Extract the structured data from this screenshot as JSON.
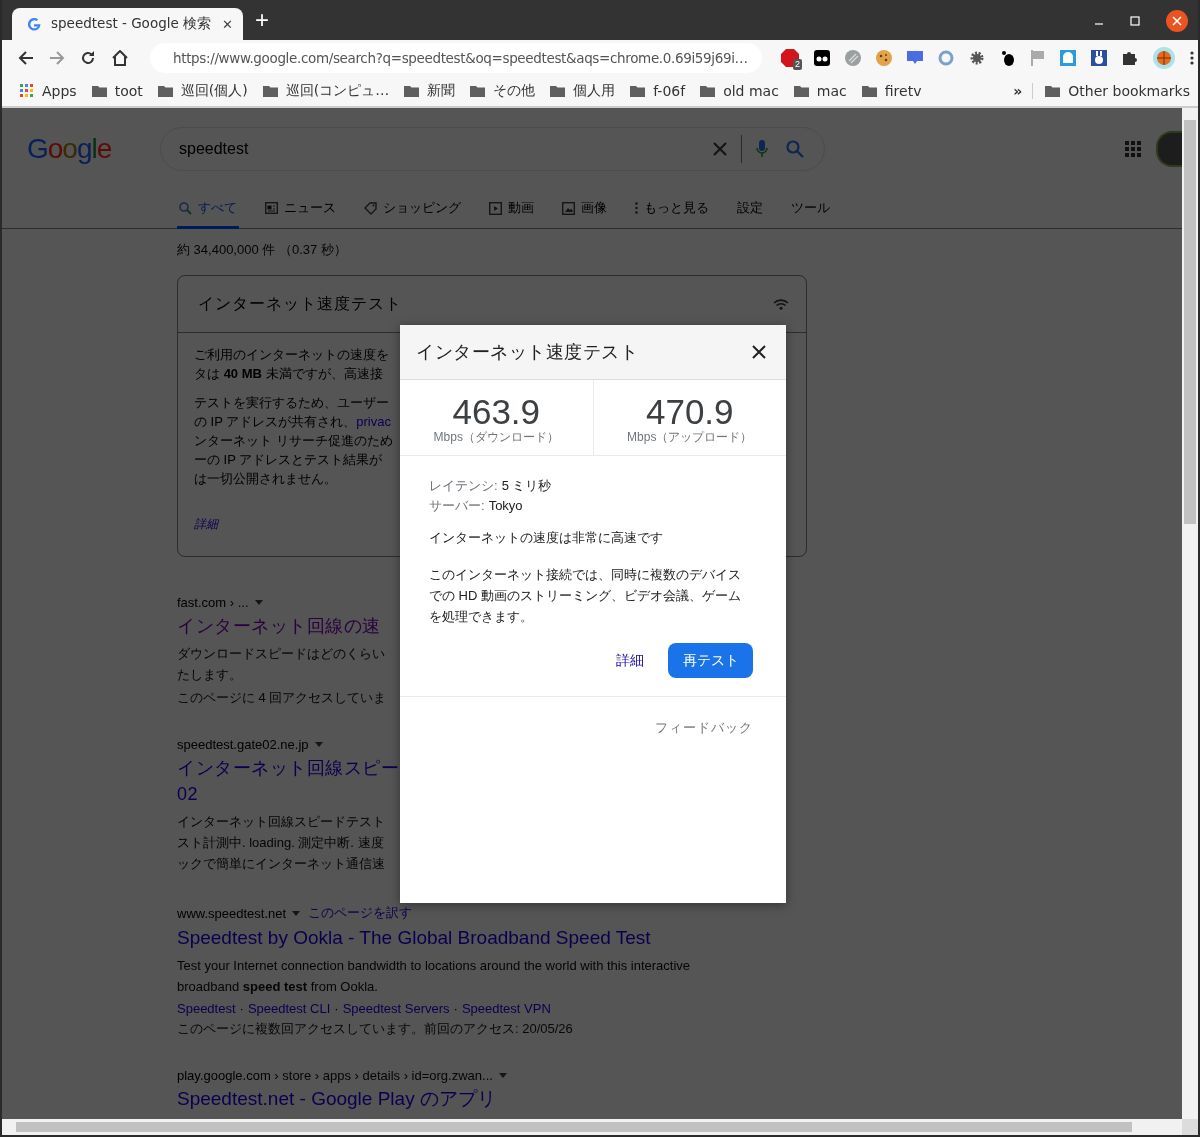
{
  "browser": {
    "tab_title": "speedtest - Google 検索",
    "new_tab": "+",
    "close_tab": "✕",
    "url": "https://www.google.com/search?q=speedtest&oq=speedtest&aqs=chrome.0.69i59j69i…",
    "extension_badge": "2",
    "bookmarks": [
      {
        "label": "Apps",
        "kind": "apps"
      },
      {
        "label": "toot",
        "kind": "folder"
      },
      {
        "label": "巡回(個人)",
        "kind": "folder"
      },
      {
        "label": "巡回(コンピュ…",
        "kind": "folder"
      },
      {
        "label": "新聞",
        "kind": "folder"
      },
      {
        "label": "その他",
        "kind": "folder"
      },
      {
        "label": "個人用",
        "kind": "folder"
      },
      {
        "label": "f-06f",
        "kind": "folder"
      },
      {
        "label": "old mac",
        "kind": "folder"
      },
      {
        "label": "mac",
        "kind": "folder"
      },
      {
        "label": "firetv",
        "kind": "folder"
      }
    ],
    "overflow": "»",
    "other_bookmarks": "Other bookmarks"
  },
  "search": {
    "logo": "Google",
    "query": "speedtest",
    "sitelink_separator": "·",
    "tabs": [
      {
        "label": "すべて",
        "kind": "search",
        "selected": true
      },
      {
        "label": "ニュース",
        "kind": "news",
        "selected": false
      },
      {
        "label": "ショッピング",
        "kind": "tag",
        "selected": false
      },
      {
        "label": "動画",
        "kind": "video",
        "selected": false
      },
      {
        "label": "画像",
        "kind": "image",
        "selected": false
      },
      {
        "label": "もっと見る",
        "kind": "more",
        "selected": false
      },
      {
        "label": "設定",
        "kind": "plain",
        "selected": false
      },
      {
        "label": "ツール",
        "kind": "plain",
        "selected": false
      }
    ],
    "stats": "約 34,400,000 件 （0.37 秒）"
  },
  "card": {
    "title": "インターネット速度テスト",
    "paragraphs": [
      [
        {
          "text": "ご利用のインターネットの速度を"
        },
        {
          "text": "タは **40 MB** 未満ですが、高速接"
        }
      ],
      [
        {
          "text": "テストを実行するため、ユーザー"
        },
        {
          "text": "の IP アドレスが共有され、",
          "link": "privac"
        },
        {
          "text": "ンターネット リサーチ促進のため"
        },
        {
          "text": "ーの IP アドレスとテスト結果が"
        },
        {
          "text": "は一切公開されません。"
        }
      ]
    ],
    "more": "詳細"
  },
  "results": [
    {
      "cite": "fast.com",
      "cite_path": " › ...",
      "title_lines": [
        "インターネット回線の速"
      ],
      "visited_link": true,
      "snippet": [
        "ダウンロードスピードはどのくらい",
        "たします。"
      ],
      "visits": "このページに 4 回アクセスしていま"
    },
    {
      "cite": "speedtest.gate02.ne.jp",
      "title_lines": [
        "インターネット回線スピー",
        "02"
      ],
      "visited_link": false,
      "snippet": [
        "インターネット回線スピードテスト",
        "スト計測中. loading. 測定中断. 速度",
        "ックで簡単にインターネット通信速"
      ]
    },
    {
      "cite": "www.speedtest.net",
      "translate": "このページを訳す",
      "title_lines": [
        "Speedtest by Ookla - The Global Broadband Speed Test"
      ],
      "visited_link": false,
      "snippet": [
        "Test your Internet connection bandwidth to locations around the world with this interactive",
        "broadband **speed test** from Ookla."
      ],
      "sitelinks": [
        "Speedtest",
        "Speedtest CLI",
        "Speedtest Servers",
        "Speedtest VPN"
      ],
      "visits": "このページに複数回アクセスしています。前回のアクセス: 20/05/26"
    },
    {
      "cite": "play.google.com",
      "cite_path": " › store › apps › details › id=org.zwan...",
      "title_lines": [
        "Speedtest.net - Google Play のアプリ"
      ],
      "visited_link": false
    }
  ],
  "dialog": {
    "title": "インターネット速度テスト",
    "stats": [
      {
        "value": "463.9",
        "unit": "Mbps（ダウンロード）"
      },
      {
        "value": "470.9",
        "unit": "Mbps（アップロード）"
      }
    ],
    "details": [
      {
        "label": "レイテンシ:",
        "value": "5 ミリ秒"
      },
      {
        "label": "サーバー:",
        "value": "Tokyo"
      }
    ],
    "summary": "インターネットの速度は非常に高速です",
    "description": "このインターネット接続では、同時に複数のデバイスでの HD 動画のストリーミング、ビデオ会議、ゲームを処理できます。",
    "details_link": "詳細",
    "retest": "再テスト",
    "feedback": "フィードバック"
  }
}
